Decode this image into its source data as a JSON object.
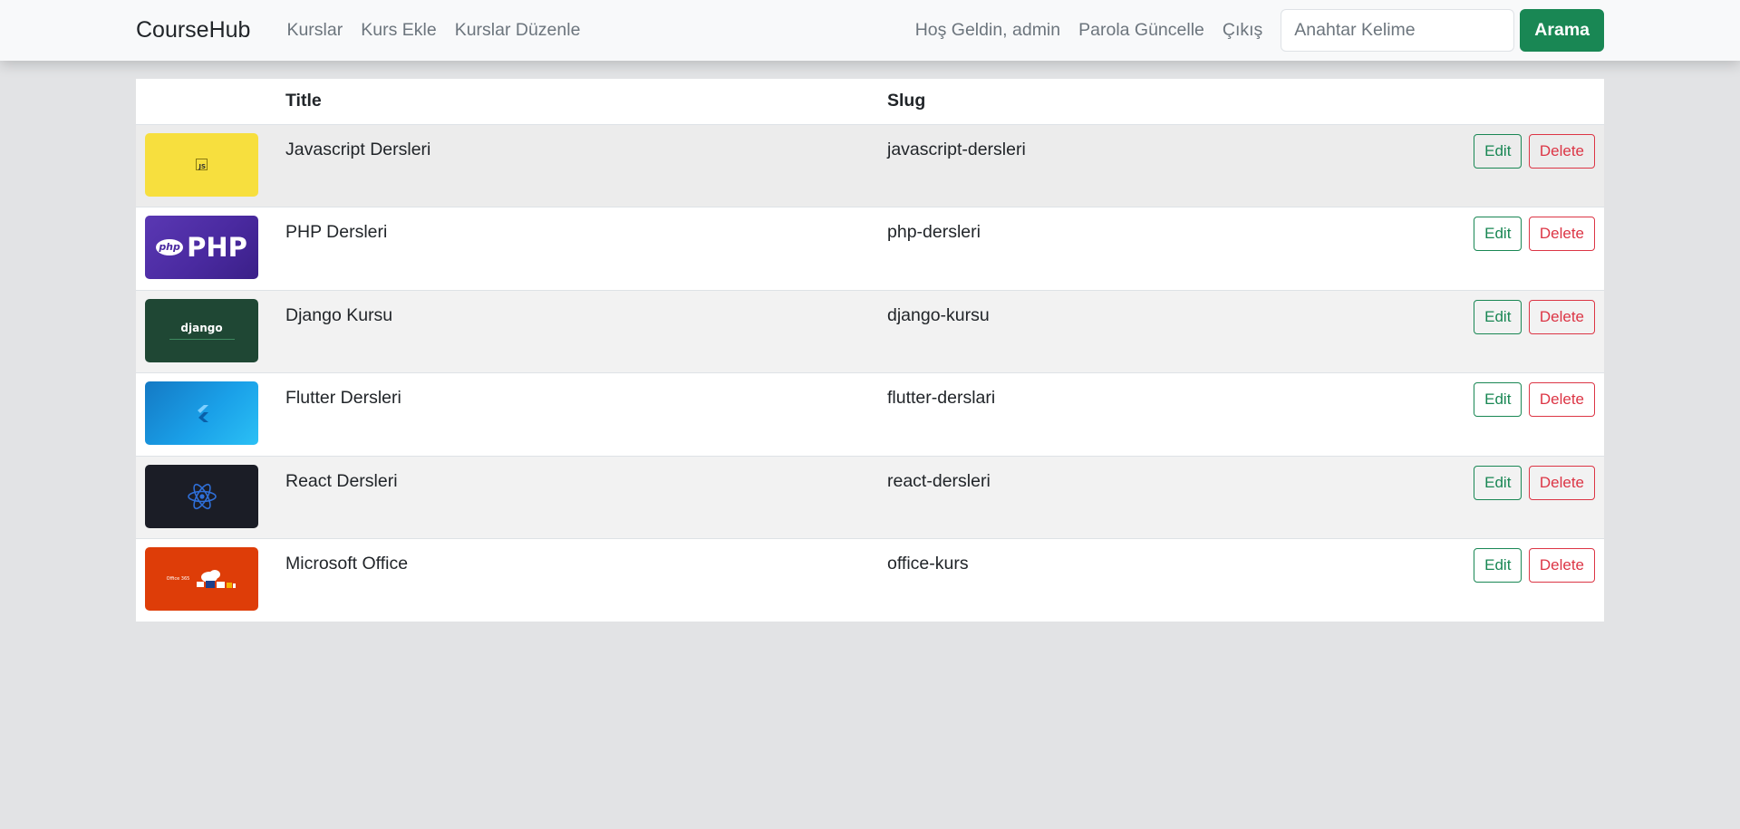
{
  "nav": {
    "brand": "CourseHub",
    "left_links": [
      "Kurslar",
      "Kurs Ekle",
      "Kurslar Düzenle"
    ],
    "welcome": "Hoş Geldin, admin",
    "password": "Parola Güncelle",
    "logout": "Çıkış",
    "search_placeholder": "Anahtar Kelime",
    "search_button": "Arama"
  },
  "table": {
    "columns": [
      "",
      "Title",
      "Slug",
      ""
    ],
    "edit_label": "Edit",
    "delete_label": "Delete",
    "rows": [
      {
        "title": "Javascript Dersleri",
        "slug": "javascript-dersleri",
        "thumb_label": "JS",
        "thumb_color": "#f7df3e",
        "thumb_icon": "js-logo-icon"
      },
      {
        "title": "PHP Dersleri",
        "slug": "php-dersleri",
        "thumb_label": "PHP",
        "thumb_badge": "php",
        "thumb_color": "#4f2fa6",
        "thumb_icon": "php-logo-icon"
      },
      {
        "title": "Django Kursu",
        "slug": "django-kursu",
        "thumb_label": "django",
        "thumb_color": "#1f4734",
        "thumb_icon": "django-logo-icon"
      },
      {
        "title": "Flutter Dersleri",
        "slug": "flutter-derslari",
        "thumb_color": "#1a8fd8",
        "thumb_icon": "flutter-logo-icon"
      },
      {
        "title": "React Dersleri",
        "slug": "react-dersleri",
        "thumb_color": "#1b1d26",
        "thumb_icon": "react-logo-icon"
      },
      {
        "title": "Microsoft Office",
        "slug": "office-kurs",
        "thumb_label": "Office 365",
        "thumb_color": "#de3d08",
        "thumb_icon": "office-logo-icon"
      }
    ]
  }
}
